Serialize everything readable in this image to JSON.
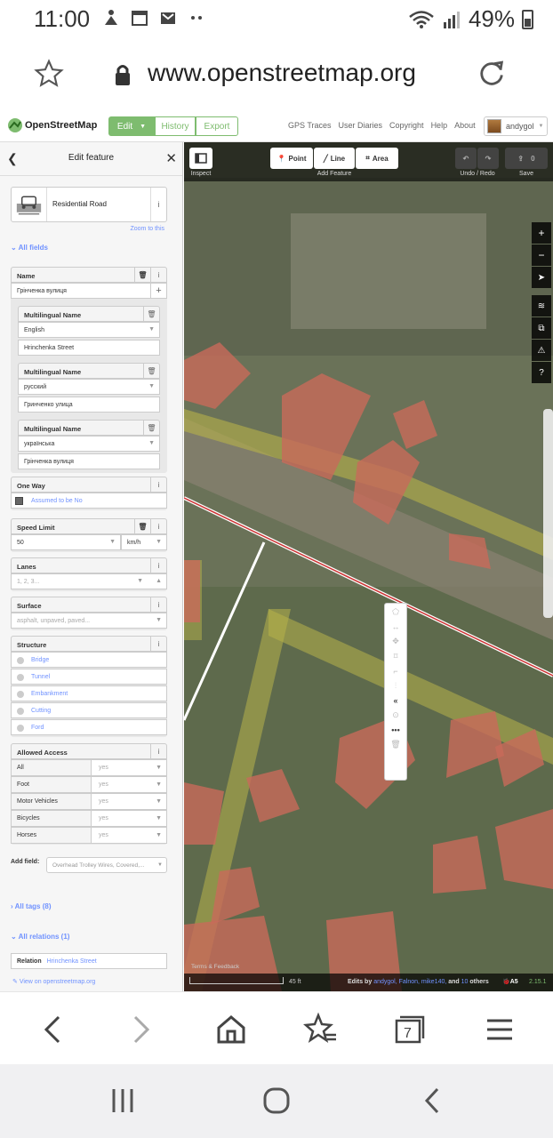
{
  "status": {
    "time": "11:00",
    "battery": "49%"
  },
  "browser": {
    "url": "www.openstreetmap.org"
  },
  "osm": {
    "title": "OpenStreetMap",
    "edit_label": "Edit",
    "history_label": "History",
    "export_label": "Export",
    "links": [
      "GPS Traces",
      "User Diaries",
      "Copyright",
      "Help",
      "About"
    ],
    "username": "andygol"
  },
  "sidebar": {
    "title": "Edit feature",
    "preset_name": "Residential Road",
    "zoom_to": "Zoom to this",
    "all_fields": "All fields",
    "name_label": "Name",
    "name_value": "Грінченка вулиця",
    "multilingual": [
      {
        "label": "Multilingual Name",
        "lang": "English",
        "value": "Hrinchenka Street"
      },
      {
        "label": "Multilingual Name",
        "lang": "русский",
        "value": "Гринченко улица"
      },
      {
        "label": "Multilingual Name",
        "lang": "українська",
        "value": "Грінченка вулиця"
      }
    ],
    "oneway_label": "One Way",
    "oneway_value": "Assumed to be No",
    "speed_label": "Speed Limit",
    "speed_value": "50",
    "speed_unit": "km/h",
    "lanes_label": "Lanes",
    "lanes_placeholder": "1, 2, 3...",
    "surface_label": "Surface",
    "surface_placeholder": "asphalt, unpaved, paved...",
    "structure_label": "Structure",
    "structure_options": [
      "Bridge",
      "Tunnel",
      "Embankment",
      "Cutting",
      "Ford"
    ],
    "access_label": "Allowed Access",
    "access_rows": [
      {
        "key": "All",
        "value": "yes"
      },
      {
        "key": "Foot",
        "value": "yes"
      },
      {
        "key": "Motor Vehicles",
        "value": "yes"
      },
      {
        "key": "Bicycles",
        "value": "yes"
      },
      {
        "key": "Horses",
        "value": "yes"
      }
    ],
    "add_field_label": "Add field:",
    "add_field_placeholder": "Overhead Trolley Wires, Covered,...",
    "all_tags": "All tags (8)",
    "all_relations": "All relations (1)",
    "relation_type": "Relation",
    "relation_name": "Hrinchenka Street",
    "view_on_osm": "View on openstreetmap.org"
  },
  "map": {
    "inspect": "Inspect",
    "point": "Point",
    "line": "Line",
    "area": "Area",
    "add_feature": "Add Feature",
    "undo_redo": "Undo / Redo",
    "save": "Save",
    "save_count": "0",
    "scale": "45 ft",
    "edits_by_prefix": "Edits by",
    "edits_users": "andygol, Falnon, mike140,",
    "edits_and": "and",
    "edits_others": "10",
    "edits_suffix": "others",
    "version": "2.15.1",
    "issues": "A5",
    "imagery_feedback": "Terms & Feedback"
  }
}
